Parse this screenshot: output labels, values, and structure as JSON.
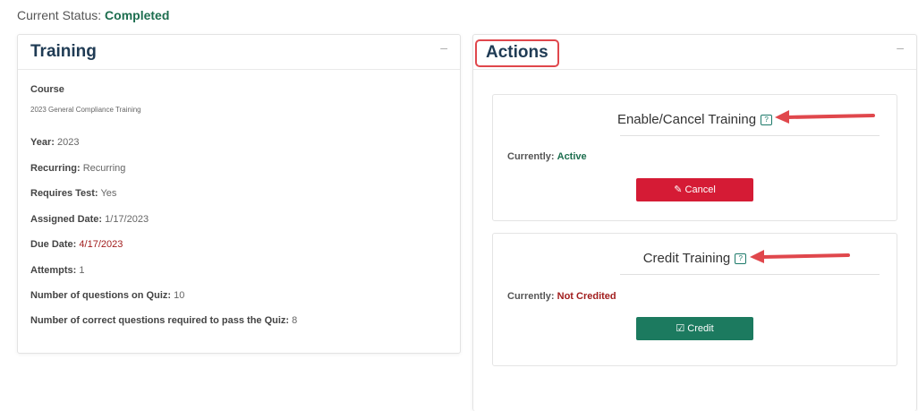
{
  "status": {
    "label": "Current Status:",
    "value": "Completed"
  },
  "training": {
    "title": "Training",
    "collapse": "–",
    "course_label": "Course",
    "course_name": "2023 General Compliance Training",
    "fields": [
      {
        "label": "Year:",
        "value": "2023",
        "value_color": "normal"
      },
      {
        "label": "Recurring:",
        "value": "Recurring",
        "value_color": "normal"
      },
      {
        "label": "Requires Test:",
        "value": "Yes",
        "value_color": "normal"
      },
      {
        "label": "Assigned Date:",
        "value": "1/17/2023",
        "value_color": "normal"
      },
      {
        "label": "Due Date:",
        "value": "4/17/2023",
        "value_color": "red"
      },
      {
        "label": "Attempts:",
        "value": "1",
        "value_color": "normal"
      },
      {
        "label": "Number of questions on Quiz:",
        "value": "10",
        "value_color": "normal"
      },
      {
        "label": "Number of correct questions required to pass the Quiz:",
        "value": "8",
        "value_color": "normal"
      }
    ]
  },
  "actions": {
    "title": "Actions",
    "collapse": "–",
    "enable_card": {
      "title": "Enable/Cancel Training",
      "help_icon": "help-icon",
      "currently_label": "Currently:",
      "currently_value": "Active",
      "button_icon": "edit-icon",
      "button_label": "Cancel"
    },
    "credit_card": {
      "title": "Credit Training",
      "help_icon": "help-icon",
      "currently_label": "Currently:",
      "currently_value": "Not Credited",
      "button_icon": "clipboard-check-icon",
      "button_label": "Credit"
    }
  },
  "colors": {
    "accent_green": "#1d6e4f",
    "danger_red": "#d51b35",
    "credit_green": "#1c7a5f",
    "annotation_red": "#e0474c"
  }
}
